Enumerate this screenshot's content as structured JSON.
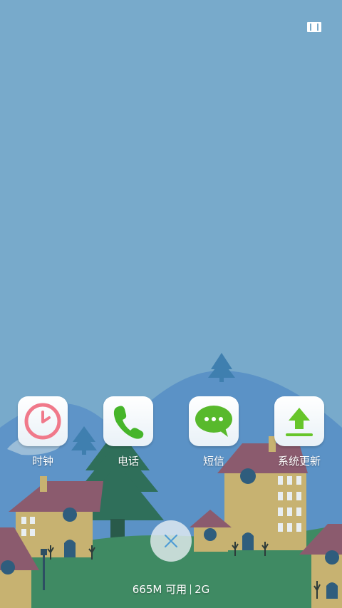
{
  "status_bar": {
    "icon": "battery-icon"
  },
  "apps": [
    {
      "label": "时钟",
      "icon": "clock-icon",
      "accent": "#f0798a"
    },
    {
      "label": "电话",
      "icon": "phone-icon",
      "accent": "#46b52a"
    },
    {
      "label": "短信",
      "icon": "message-icon",
      "accent": "#58b92c"
    },
    {
      "label": "系统更新",
      "icon": "upload-icon",
      "accent": "#67c52a"
    }
  ],
  "close_button": {
    "icon": "close-icon",
    "color": "#4a9ad6"
  },
  "memory": {
    "available": "665M 可用",
    "network": "2G"
  },
  "colors": {
    "sky": "#78aacb",
    "hills": "#5b92c6",
    "grass": "#3f8a63"
  }
}
